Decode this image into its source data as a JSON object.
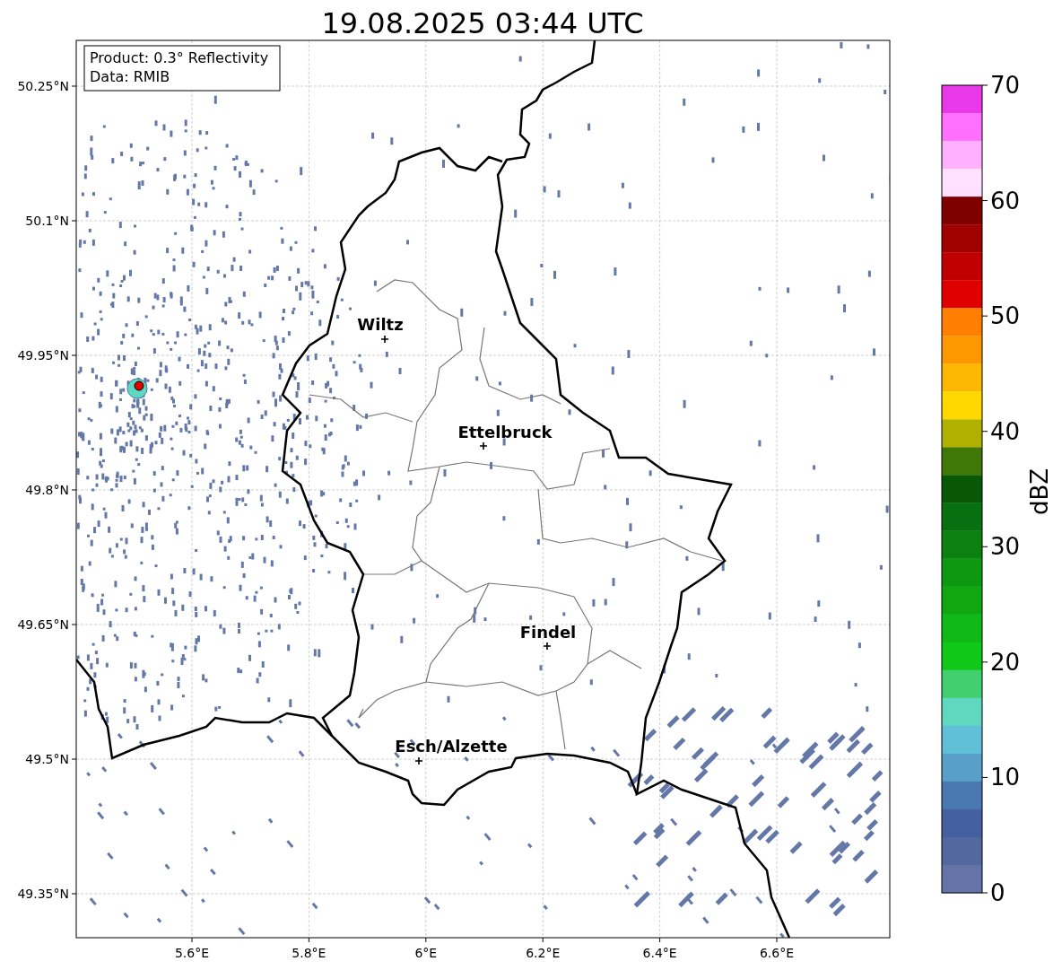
{
  "title": "19.08.2025 03:44 UTC",
  "info_box": [
    "Product: 0.3° Reflectivity",
    "Data: RMIB"
  ],
  "x_ticks": [
    "5.6°E",
    "5.8°E",
    "6°E",
    "6.2°E",
    "6.4°E",
    "6.6°E"
  ],
  "y_ticks": [
    "50.25°N",
    "50.1°N",
    "49.95°N",
    "49.8°N",
    "49.65°N",
    "49.5°N",
    "49.35°N"
  ],
  "cities": [
    {
      "name": "Wiltz"
    },
    {
      "name": "Ettelbruck"
    },
    {
      "name": "Findel"
    },
    {
      "name": "Esch/Alzette"
    }
  ],
  "colorbar": {
    "label": "dBZ",
    "ticks": [
      "70",
      "60",
      "50",
      "40",
      "30",
      "20",
      "10",
      "0"
    ],
    "bins": [
      {
        "color": "#e838e8"
      },
      {
        "color": "#ff70ff"
      },
      {
        "color": "#ffb0ff"
      },
      {
        "color": "#ffe0ff"
      },
      {
        "color": "#800000"
      },
      {
        "color": "#a00000"
      },
      {
        "color": "#c00000"
      },
      {
        "color": "#e00000"
      },
      {
        "color": "#ff8000"
      },
      {
        "color": "#ff9800"
      },
      {
        "color": "#fcb800"
      },
      {
        "color": "#ffd800"
      },
      {
        "color": "#b0b000"
      },
      {
        "color": "#407808"
      },
      {
        "color": "#085808"
      },
      {
        "color": "#087010"
      },
      {
        "color": "#0c8010"
      },
      {
        "color": "#0c9810"
      },
      {
        "color": "#10a810"
      },
      {
        "color": "#10b818"
      },
      {
        "color": "#10c818"
      },
      {
        "color": "#40d070"
      },
      {
        "color": "#60d8c0"
      },
      {
        "color": "#60c0d8"
      },
      {
        "color": "#58a0c8"
      },
      {
        "color": "#4a78b0"
      },
      {
        "color": "#4460a0"
      },
      {
        "color": "#5468a0"
      },
      {
        "color": "#6474a8"
      }
    ]
  }
}
